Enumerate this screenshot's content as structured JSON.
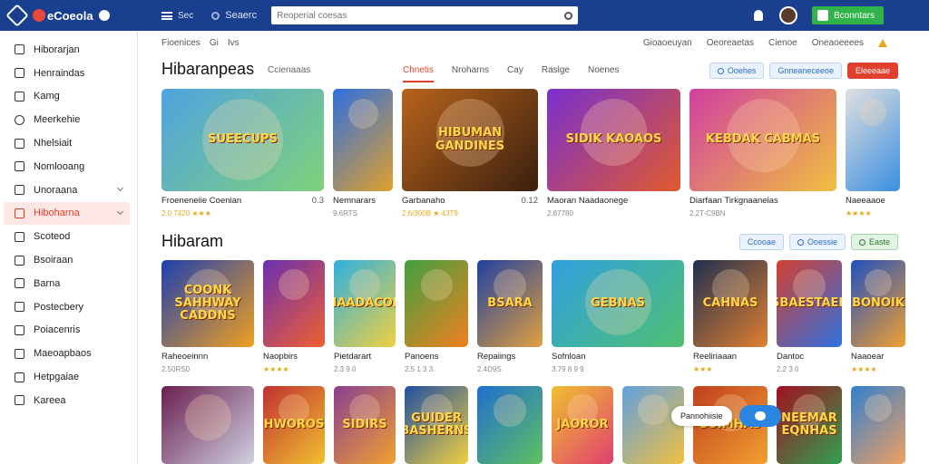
{
  "topbar": {
    "logo_text": "eCoeola",
    "menu_label": "Sec",
    "search_small_label": "Seaerc",
    "search_placeholder": "Reoperial coesas",
    "cta_label": "Bconntars"
  },
  "sidebar": {
    "items": [
      {
        "label": "Hiborarjan",
        "icon": "home-icon"
      },
      {
        "label": "Henraindas",
        "icon": "grid-icon"
      },
      {
        "label": "Kamg",
        "icon": "doc-icon"
      },
      {
        "label": "Meerkehie",
        "icon": "clock-icon"
      },
      {
        "label": "Nhelsiait",
        "icon": "list-icon"
      },
      {
        "label": "Nomlooang",
        "icon": "box-icon"
      },
      {
        "label": "Unoraana",
        "icon": "layers-icon"
      },
      {
        "label": "Hiboharna",
        "icon": "flag-icon"
      },
      {
        "label": "Scoteod",
        "icon": "gear-icon"
      },
      {
        "label": "Bsoiraan",
        "icon": "home-icon"
      },
      {
        "label": "Barna",
        "icon": "pen-icon"
      },
      {
        "label": "Postecbery",
        "icon": "edit-icon"
      },
      {
        "label": "Poiacenris",
        "icon": "chat-icon"
      },
      {
        "label": "Maeoapbaos",
        "icon": "chart-icon"
      },
      {
        "label": "Hetpgaiae",
        "icon": "doc-icon"
      },
      {
        "label": "Kareea",
        "icon": "share-icon"
      }
    ]
  },
  "crumbs": {
    "left": [
      "Fioenices",
      "Gi",
      "Ivs"
    ],
    "right": [
      "Gioaoeuyan",
      "Oeoreaetas",
      "Cienoe",
      "Oneaoeeees"
    ]
  },
  "section1": {
    "title": "Hibaranpeas",
    "sub_label": "Ccienaaas",
    "tabs": [
      "Chnetis",
      "Nroharns",
      "Cay",
      "Raslge",
      "Noenes"
    ],
    "pills": [
      "Ooehes",
      "Gnneaneceeoe",
      "Eleeeaae"
    ],
    "cards": [
      {
        "title": "Froeneneiie Coenian",
        "num": "0.3",
        "meta": "2.0 7420 ★★★",
        "art": "SUEECUPS"
      },
      {
        "title": "Nemnarars",
        "num": "",
        "meta": "9.6RTS",
        "art": ""
      },
      {
        "title": "Garbanaho",
        "num": "0.12",
        "meta": "2.6/300B ★ 43T9",
        "art": "HIBUMAN GANDINES"
      },
      {
        "title": "Maoran Naadaonege",
        "num": "",
        "meta": "2.87780",
        "art": "SIDIK KAOAOS"
      },
      {
        "title": "Diarfaan Tirkgnaaneias",
        "num": "",
        "meta": "2.2T-C9BN",
        "art": "KEBDAK CABMAS"
      },
      {
        "title": "Naeeaaoe",
        "num": "",
        "meta": "★★★★",
        "art": ""
      }
    ]
  },
  "section2": {
    "title": "Hibaram",
    "pills": [
      "Ccooae",
      "Ooessie",
      "Easte"
    ],
    "cards": [
      {
        "title": "Raheoeinnn",
        "meta": "2.50RS0",
        "art": "COONK SAHHWAY CADDNS"
      },
      {
        "title": "Naopbirs",
        "meta": "★★★★",
        "art": ""
      },
      {
        "title": "Pietdarart",
        "meta": "2.3 9 0",
        "art": "NAADACON"
      },
      {
        "title": "Panoens",
        "meta": "2.5 1 3 3",
        "art": ""
      },
      {
        "title": "Repaiings",
        "meta": "2.4D9S",
        "art": "BSARA"
      },
      {
        "title": "Sofnloan",
        "meta": "3.79 8 9 9",
        "art": "GEBNAS"
      },
      {
        "title": "Reeliriaaan",
        "meta": "★★★",
        "art": "CAHNAS"
      },
      {
        "title": "Dantoc",
        "meta": "2.2 3 0",
        "art": "SBAESTAEP"
      },
      {
        "title": "Naaoear",
        "meta": "★★★★",
        "art": "BONOIK"
      }
    ]
  },
  "section3": {
    "cards": [
      {
        "art": ""
      },
      {
        "art": "HWOROS"
      },
      {
        "art": "SIDIRS"
      },
      {
        "art": "GUIDER BASHERNS"
      },
      {
        "art": ""
      },
      {
        "art": "JAOROR"
      },
      {
        "art": ""
      },
      {
        "art": "SUIMHAS"
      },
      {
        "art": "NEEMAR EQNHAS"
      },
      {
        "art": ""
      }
    ]
  },
  "chat": {
    "label": "Pannohiisie"
  },
  "colors": {
    "topbar": "#1b3f8f",
    "accent": "#e0402f",
    "cta": "#2fb34a",
    "link": "#2b6cc4"
  }
}
